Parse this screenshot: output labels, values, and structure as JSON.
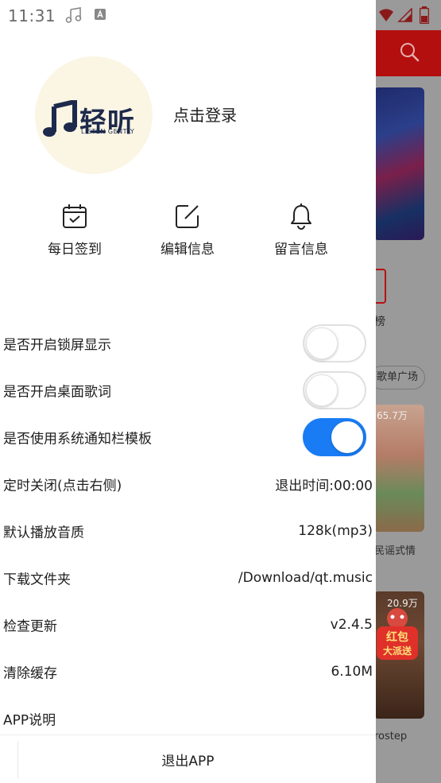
{
  "status_bar": {
    "time": "11:31"
  },
  "background_app": {
    "rank_label": "榜",
    "chip_label": "歌单广场",
    "card1": {
      "count": "65.7万",
      "label": "民谣式情"
    },
    "card2": {
      "count": "20.9万",
      "label": "rostep"
    },
    "red_packet": {
      "line1": "红包",
      "line2": "大派送"
    }
  },
  "drawer": {
    "logo": {
      "text": "轻听",
      "subtext": "LISTEN GENTLY"
    },
    "login_label": "点击登录",
    "actions": [
      {
        "label": "每日签到",
        "icon": "calendar-check-icon"
      },
      {
        "label": "编辑信息",
        "icon": "edit-icon"
      },
      {
        "label": "留言信息",
        "icon": "bell-icon"
      }
    ],
    "settings": [
      {
        "label": "是否开启锁屏显示",
        "toggle": false
      },
      {
        "label": "是否开启桌面歌词",
        "toggle": false
      },
      {
        "label": "是否使用系统通知栏模板",
        "toggle": true
      },
      {
        "label": "定时关闭(点击右侧)",
        "value": "退出时间:00:00"
      },
      {
        "label": "默认播放音质",
        "value": "128k(mp3)"
      },
      {
        "label": "下载文件夹",
        "value": "/Download/qt.music"
      },
      {
        "label": "检查更新",
        "value": "v2.4.5"
      },
      {
        "label": "清除缓存",
        "value": "6.10M"
      },
      {
        "label": "APP说明"
      }
    ],
    "logout_label": "退出APP"
  },
  "colors": {
    "accent": "#1a7cf5",
    "brand_red": "#b30f0f",
    "logo_navy": "#1d2a4c"
  }
}
